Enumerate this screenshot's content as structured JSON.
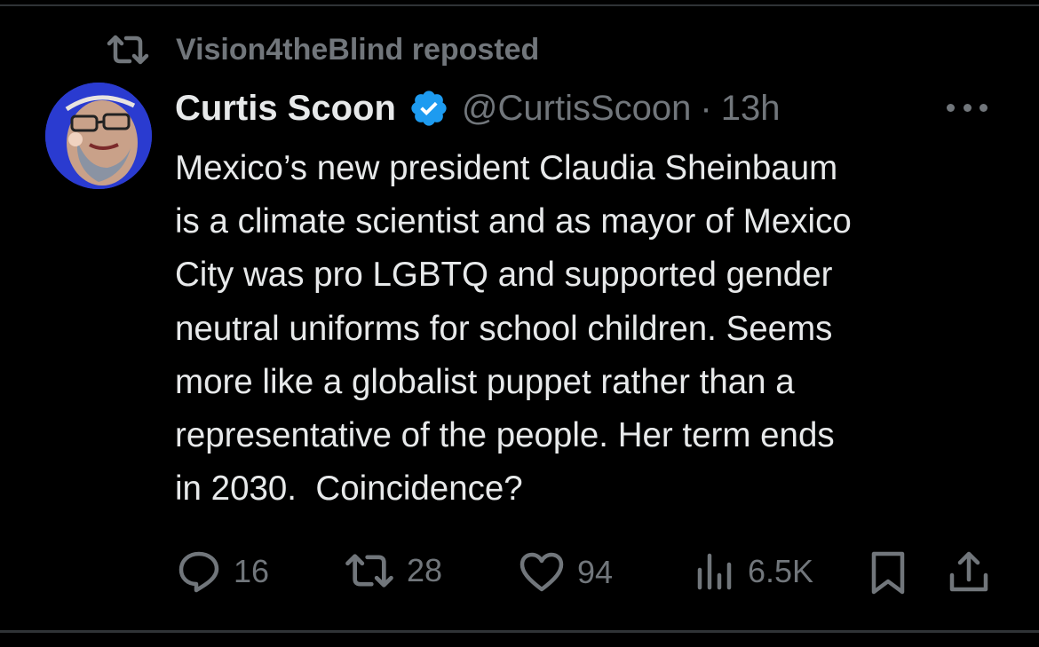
{
  "repost": {
    "label": "Vision4theBlind reposted"
  },
  "author": {
    "display_name": "Curtis Scoon",
    "handle": "@CurtisScoon",
    "separator": "·",
    "time": "13h",
    "verified": true
  },
  "tweet": {
    "text": "Mexico’s new president Claudia Sheinbaum\nis a climate scientist and as mayor of Mexico\nCity was pro LGBTQ and supported gender\nneutral uniforms for school children. Seems\nmore like a globalist puppet rather than a\nrepresentative of the people. Her term ends\nin 2030.  Coincidence?"
  },
  "stats": {
    "replies": "16",
    "reposts": "28",
    "likes": "94",
    "views": "6.5K"
  },
  "icons": {
    "repost": "repost-icon",
    "reply": "reply-icon",
    "like": "heart-icon",
    "views": "views-icon",
    "bookmark": "bookmark-icon",
    "share": "share-icon",
    "verified": "verified-badge-icon",
    "more": "more-options-icon"
  },
  "colors": {
    "background": "#000000",
    "text": "#e7e9ea",
    "muted": "#71767b",
    "verified_blue": "#1d9bf0",
    "divider": "#2f3336"
  }
}
